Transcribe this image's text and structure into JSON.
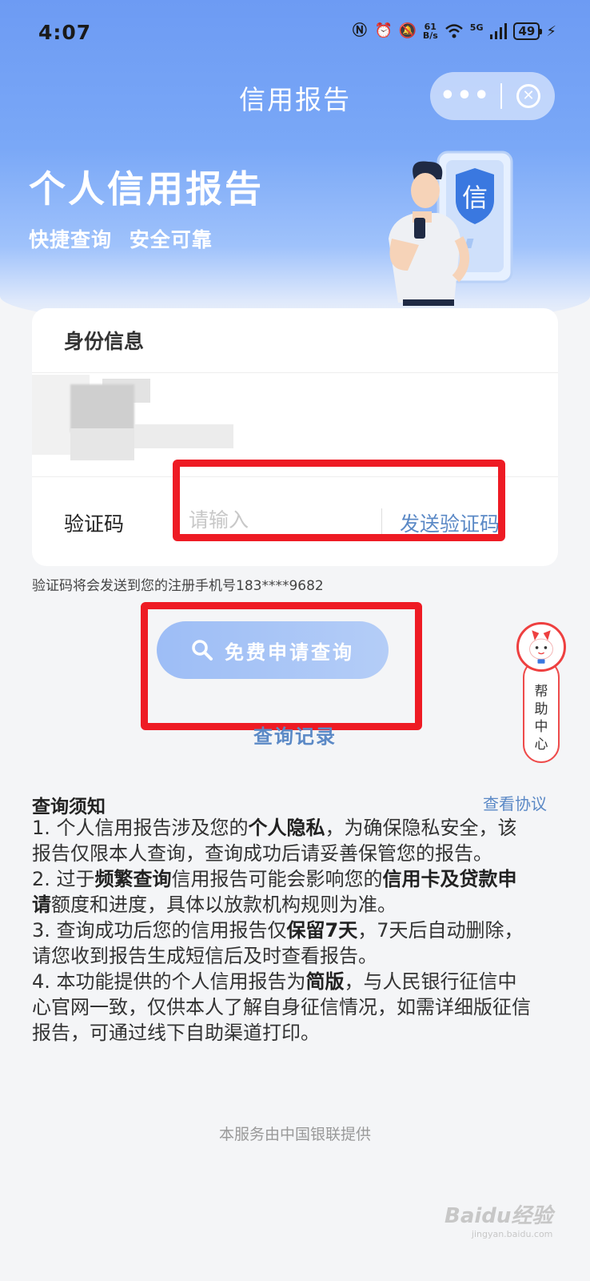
{
  "status_bar": {
    "time": "4:07",
    "net_speed_value": "61",
    "net_speed_unit": "B/s",
    "signal_label": "5G",
    "battery": "49"
  },
  "nav": {
    "title": "信用报告",
    "more_label": "•••",
    "close_label": "✕"
  },
  "hero": {
    "title": "个人信用报告",
    "subtitle": "快捷查询   安全可靠",
    "badge_char": "信"
  },
  "form": {
    "section_title": "身份信息",
    "code_label": "验证码",
    "code_placeholder": "请输入",
    "send_label": "发送验证码",
    "notice": "验证码将会发送到您的注册手机号183****9682"
  },
  "actions": {
    "query_button": "免费申请查询",
    "records_link": "查询记录"
  },
  "help": {
    "label_1": "帮",
    "label_2": "助",
    "label_3": "中",
    "label_4": "心"
  },
  "notice_section": {
    "title": "查询须知",
    "agreement_link": "查看协议",
    "rules": [
      [
        "1. 个人信用报告涉及您的",
        "个人隐私",
        "，为确保隐私安全，该报告仅限本人查询，查询成功后请妥善保管您的报告。"
      ],
      [
        "2. 过于",
        "频繁查询",
        "信用报告可能会影响您的",
        "信用卡及贷款申请",
        "额度和进度，具体以放款机构规则为准。"
      ],
      [
        "3. 查询成功后您的信用报告仅",
        "保留7天",
        "，7天后自动删除，请您收到报告生成短信后及时查看报告。"
      ],
      [
        "4. 本功能提供的个人信用报告为",
        "简版",
        "，与人民银行征信中心官网一致，仅供本人了解自身征信情况，如需详细版征信报告，可通过线下自助渠道打印。"
      ]
    ]
  },
  "footer": "本服务由中国银联提供",
  "watermark": {
    "brand": "Baidu经验",
    "url": "jingyan.baidu.com"
  },
  "colors": {
    "primary_blue": "#5b89c6",
    "highlight_red": "#ee1b24",
    "button_blue": "#9dbdf6"
  }
}
